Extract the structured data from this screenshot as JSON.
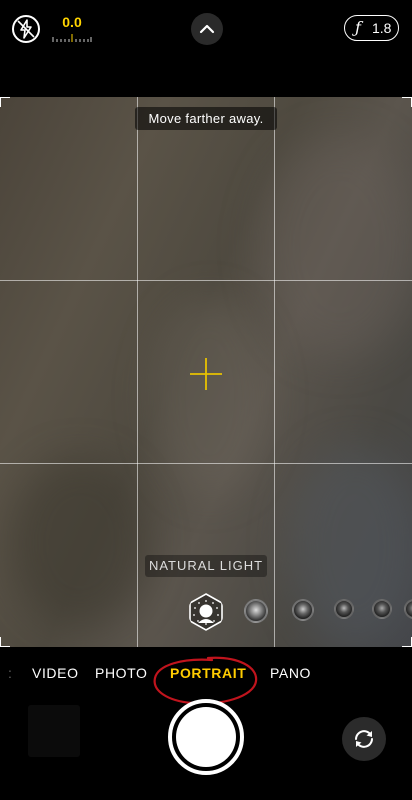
{
  "top_bar": {
    "flash_icon": "flash-off-icon",
    "exposure_value": "0.0",
    "expand_icon": "chevron-up-icon",
    "aperture_icon": "f-stop-icon",
    "aperture_value": "1.8"
  },
  "viewfinder": {
    "hint": "Move farther away.",
    "focus_icon": "crosshair-icon",
    "lighting_label": "NATURAL LIGHT",
    "lighting_options": [
      {
        "icon": "natural-light-icon",
        "selected": true
      },
      {
        "icon": "studio-light-icon"
      },
      {
        "icon": "contour-light-icon"
      },
      {
        "icon": "stage-light-icon"
      },
      {
        "icon": "stage-light-mono-icon"
      },
      {
        "icon": "high-key-light-icon"
      }
    ]
  },
  "modes": {
    "video": "VIDEO",
    "photo": "PHOTO",
    "portrait": "PORTRAIT",
    "pano": "PANO",
    "selected": "PORTRAIT"
  },
  "controls": {
    "shutter_icon": "shutter-icon",
    "flip_icon": "camera-flip-icon"
  },
  "colors": {
    "accent": "#ffcc00",
    "annotation": "#c0141d"
  }
}
